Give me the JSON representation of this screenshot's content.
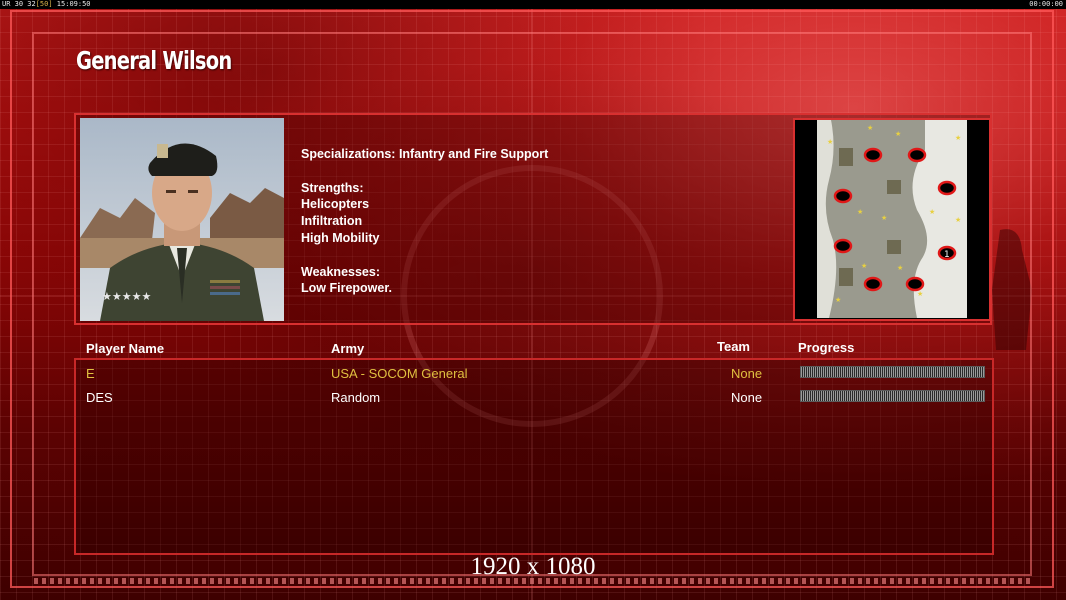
{
  "hud": {
    "left_prefix": "UR 30 32",
    "left_dim": "[50]",
    "left_time": "15:09:50",
    "right_time": "00:00:00"
  },
  "general": {
    "name": "General Wilson"
  },
  "description": {
    "specializations": "Specializations: Infantry and Fire Support",
    "strengths_label": "Strengths:",
    "strengths": [
      "Helicopters",
      "Infiltration",
      "High Mobility"
    ],
    "weaknesses_label": "Weaknesses:",
    "weaknesses": [
      "Low Firepower."
    ]
  },
  "minimap": {
    "player_marker": "1"
  },
  "players_table": {
    "headers": {
      "player_name": "Player Name",
      "army": "Army",
      "team": "Team",
      "progress": "Progress"
    },
    "rows": [
      {
        "player": "E",
        "army": "USA - SOCOM General",
        "team": "None",
        "active": true
      },
      {
        "player": "DES",
        "army": "Random",
        "team": "None",
        "active": false
      }
    ]
  },
  "resolution_label": "1920 x 1080",
  "colors": {
    "accent_red": "#d83030",
    "active_player": "#e0c040",
    "text": "#ffffff"
  }
}
